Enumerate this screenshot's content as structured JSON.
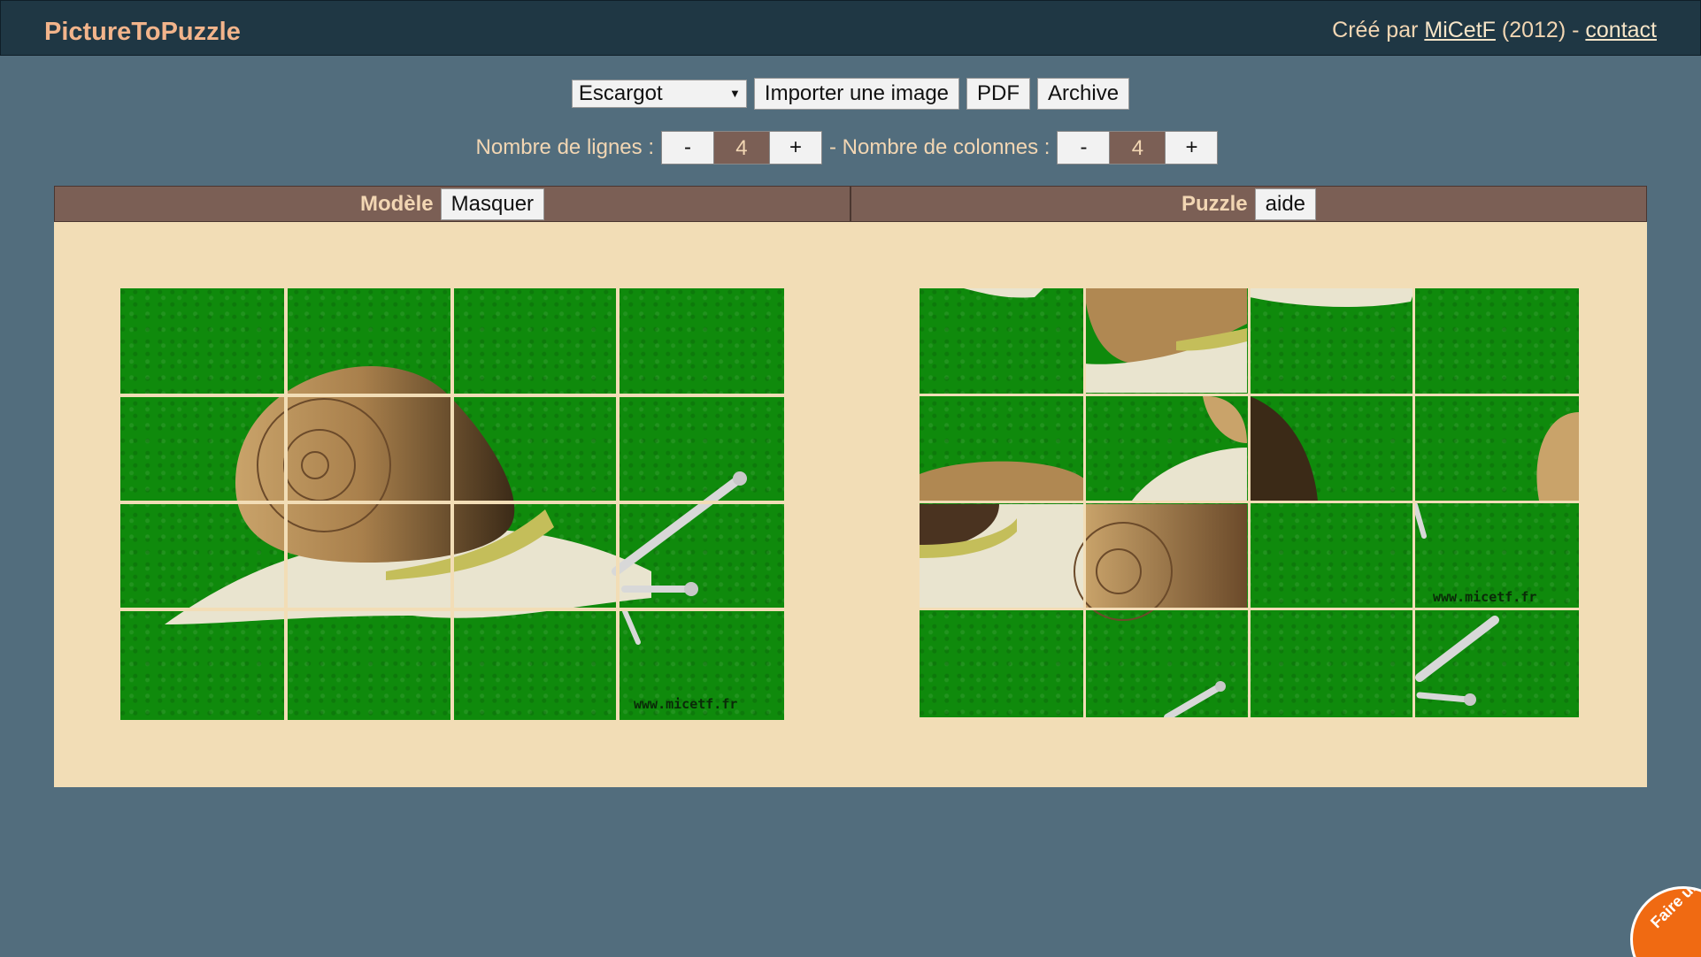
{
  "app": {
    "title": "PictureToPuzzle",
    "credit_prefix": "Créé par",
    "author": "MiCetF",
    "year": "(2012) -",
    "contact": "contact"
  },
  "toolbar": {
    "image_select_value": "Escargot",
    "import_label": "Importer une image",
    "pdf_label": "PDF",
    "archive_label": "Archive"
  },
  "sizes": {
    "rows_label": "Nombre de lignes :",
    "rows_value": "4",
    "cols_label": "- Nombre de colonnes :",
    "cols_value": "4",
    "minus": "-",
    "plus": "+"
  },
  "model_panel": {
    "title": "Modèle",
    "hide_label": "Masquer",
    "watermark": "www.micetf.fr"
  },
  "puzzle_panel": {
    "title": "Puzzle",
    "help_label": "aide",
    "watermark": "www.micetf.fr"
  },
  "donate": {
    "label": "Faire un don"
  },
  "colors": {
    "background": "#526d7d",
    "header": "#1f3744",
    "brand": "#f2b48b",
    "panel_header": "#7b5f55",
    "board": "#f2ddb6",
    "grass": "#0f8a0c",
    "donate": "#f06a12"
  }
}
